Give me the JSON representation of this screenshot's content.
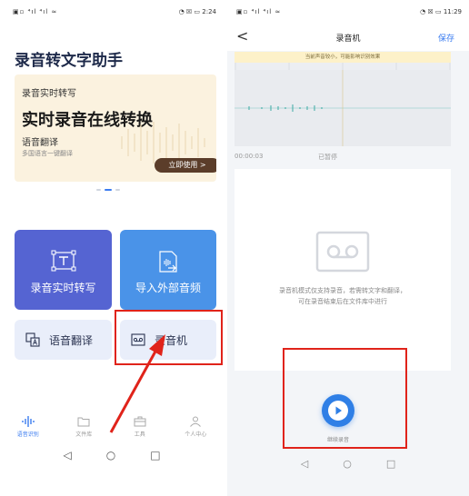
{
  "left": {
    "status": {
      "left": "▣▫ ⁴ıl ⁴ıl ≈",
      "right": "◔ ☒ ▭ 2:24"
    },
    "app_title": "录音转文字助手",
    "banner": {
      "line1": "录音实时转写",
      "headline": "实时录音在线转换",
      "line2": "语音翻译",
      "line3": "多国语言一键翻译",
      "button": "立即使用 >"
    },
    "tiles": {
      "realtime": "录音实时转写",
      "import": "导入外部音频",
      "translate": "语音翻译",
      "recorder": "录音机"
    },
    "tabs": [
      "语音识别",
      "文件库",
      "工具",
      "个人中心"
    ],
    "nav": [
      "◁",
      "○",
      "□"
    ]
  },
  "right": {
    "status": {
      "left": "▣▫ ⁴ıl ⁴ıl ≈",
      "right": "◔ ☒ ▭ 11:29"
    },
    "title": "录音机",
    "save": "保存",
    "back": "<",
    "tip": "当前声音较小，可能影响识别效果",
    "elapsed": "00:00:03",
    "paused": "已暂停",
    "description_line1": "录音机模式仅支持录音，若需转文字和翻译，",
    "description_line2": "可在录音结束后在文件库中进行",
    "continue_label": "继续录音",
    "nav": [
      "◁",
      "○",
      "□"
    ]
  },
  "colors": {
    "accent": "#3b7cf0",
    "highlight": "#e0231a",
    "tile_realtime": "#5564d2",
    "tile_import": "#4a93e8"
  }
}
